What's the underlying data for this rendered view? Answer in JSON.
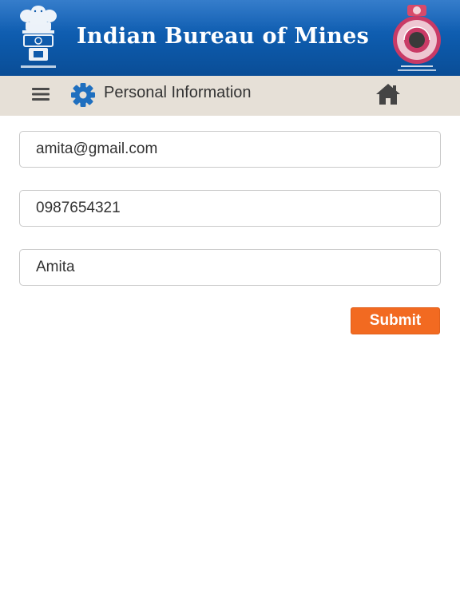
{
  "header": {
    "title": "Indian Bureau of Mines",
    "background_color": "#0d5aab",
    "left_logo_icon": "ashoka-emblem-icon",
    "right_logo_icon": "ibm-seal-icon"
  },
  "toolbar": {
    "title": "Personal Information",
    "menu_icon": "hamburger-menu-icon",
    "section_icon": "gear-icon",
    "home_icon": "home-icon",
    "background_color": "#e6e0d7"
  },
  "form": {
    "email": {
      "value": "amita@gmail.com"
    },
    "phone": {
      "value": "0987654321"
    },
    "name": {
      "value": "Amita"
    },
    "submit_label": "Submit",
    "submit_color": "#f26a21"
  }
}
